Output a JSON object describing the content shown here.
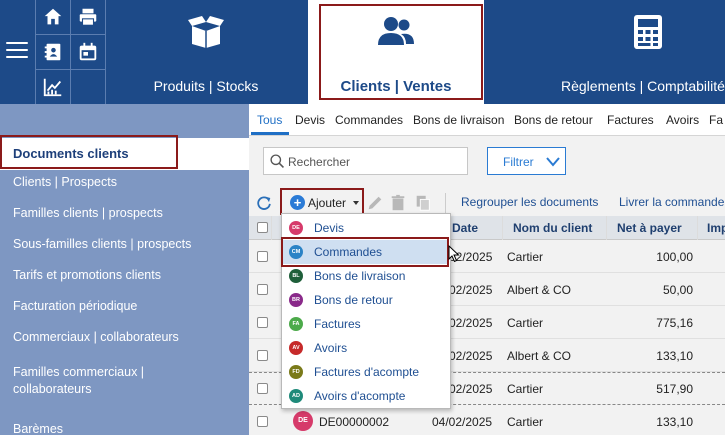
{
  "topbar": {
    "modules": [
      {
        "label": "Produits | Stocks",
        "icon": "box-icon"
      },
      {
        "label": "Clients | Ventes",
        "icon": "users-icon"
      },
      {
        "label": "Règlements | Comptabilité",
        "icon": "calculator-icon"
      }
    ],
    "quick_icons": [
      "home-icon",
      "printer-icon",
      "contacts-icon",
      "calendar-icon",
      "chart-icon"
    ]
  },
  "sidebar": {
    "items": [
      {
        "label": "Documents clients"
      },
      {
        "label": "Clients | Prospects"
      },
      {
        "label": "Familles clients | prospects"
      },
      {
        "label": "Sous-familles clients | prospects"
      },
      {
        "label": "Tarifs et promotions clients"
      },
      {
        "label": "Facturation périodique"
      },
      {
        "label": "Commerciaux | collaborateurs"
      },
      {
        "label": "Familles commerciaux | collaborateurs"
      },
      {
        "label": "Barèmes"
      }
    ]
  },
  "tabs": [
    "Tous",
    "Devis",
    "Commandes",
    "Bons de livraison",
    "Bons de retour",
    "Factures",
    "Avoirs",
    "Fa"
  ],
  "search": {
    "placeholder": "Rechercher"
  },
  "filter": {
    "label": "Filtrer"
  },
  "toolbar": {
    "add_label": "Ajouter",
    "group_label": "Regrouper les documents",
    "deliver_label": "Livrer la commande"
  },
  "table": {
    "headers": [
      "Date",
      "Nom du client",
      "Net à payer",
      "Imp"
    ],
    "rows": [
      {
        "date": "02/2025",
        "client": "Cartier",
        "net": "100,00"
      },
      {
        "date": "02/2025",
        "client": "Albert & CO",
        "net": "50,00"
      },
      {
        "date": "02/2025",
        "client": "Cartier",
        "net": "775,16"
      },
      {
        "date": "02/2025",
        "client": "Albert & CO",
        "net": "133,10"
      },
      {
        "date": "02/2025",
        "client": "Cartier",
        "net": "517,90"
      },
      {
        "badge": "DE",
        "number": "DE00000002",
        "date": "04/02/2025",
        "client": "Cartier",
        "net": "133,10"
      }
    ]
  },
  "dropdown": {
    "items": [
      {
        "code": "DE",
        "label": "Devis",
        "color": "#d63a6a"
      },
      {
        "code": "CM",
        "label": "Commandes",
        "color": "#2b83c6"
      },
      {
        "code": "BL",
        "label": "Bons de livraison",
        "color": "#1f5f3a"
      },
      {
        "code": "BR",
        "label": "Bons de retour",
        "color": "#8a2a8a"
      },
      {
        "code": "FA",
        "label": "Factures",
        "color": "#4caa4a"
      },
      {
        "code": "AV",
        "label": "Avoirs",
        "color": "#c62a2a"
      },
      {
        "code": "FD",
        "label": "Factures d'acompte",
        "color": "#7a7a1a"
      },
      {
        "code": "AD",
        "label": "Avoirs d'acompte",
        "color": "#1f8a7a"
      }
    ]
  },
  "colors": {
    "nav": "#1d4a88",
    "sidebar": "#7e97c2",
    "accent": "#1f6fc5",
    "highlight_frame": "#8b1a1a"
  }
}
